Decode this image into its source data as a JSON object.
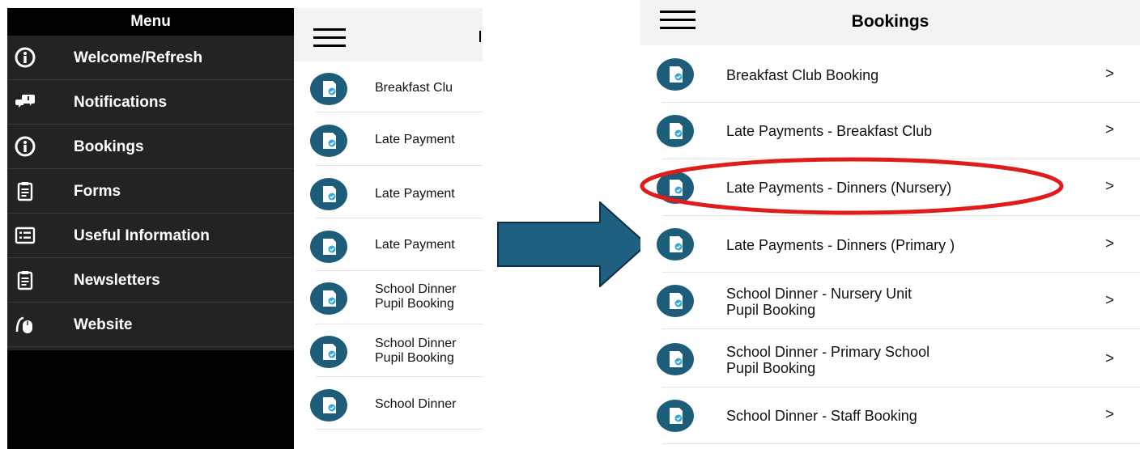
{
  "colors": {
    "menu_background": "#000000",
    "menu_list_background": "#232323",
    "topbar_background": "#f3f3f3",
    "booking_icon_color": "#1d5d79",
    "arrow_fill": "#1f5f7f",
    "highlight_ring": "#e01b1b"
  },
  "menu": {
    "title": "Menu",
    "items": [
      {
        "label": "Welcome/Refresh",
        "icon": "info-circle-icon"
      },
      {
        "label": "Notifications",
        "icon": "chat-bubbles-icon"
      },
      {
        "label": "Bookings",
        "icon": "info-circle-icon"
      },
      {
        "label": "Forms",
        "icon": "clipboard-icon"
      },
      {
        "label": "Useful Information",
        "icon": "list-card-icon"
      },
      {
        "label": "Newsletters",
        "icon": "clipboard-icon"
      },
      {
        "label": "Website",
        "icon": "mouse-click-icon"
      }
    ]
  },
  "mid_panel": {
    "rows": [
      {
        "line1": "Breakfast Clu",
        "line2": ""
      },
      {
        "line1": "Late Payment",
        "line2": ""
      },
      {
        "line1": "Late Payment",
        "line2": ""
      },
      {
        "line1": "Late Payment",
        "line2": ""
      },
      {
        "line1": "School Dinner",
        "line2": "Pupil Booking"
      },
      {
        "line1": "School Dinner",
        "line2": "Pupil Booking"
      },
      {
        "line1": "School Dinner",
        "line2": ""
      }
    ]
  },
  "bookings": {
    "title": "Bookings",
    "chevron": ">",
    "items": [
      {
        "line1": "Breakfast Club Booking",
        "line2": "",
        "highlighted": false
      },
      {
        "line1": "Late Payments - Breakfast Club",
        "line2": "",
        "highlighted": false
      },
      {
        "line1": "Late Payments - Dinners (Nursery)",
        "line2": "",
        "highlighted": true
      },
      {
        "line1": "Late Payments - Dinners (Primary )",
        "line2": "",
        "highlighted": false
      },
      {
        "line1": "School Dinner - Nursery Unit",
        "line2": "Pupil Booking",
        "highlighted": false
      },
      {
        "line1": "School Dinner - Primary School",
        "line2": "Pupil Booking",
        "highlighted": false
      },
      {
        "line1": "School Dinner - Staff Booking",
        "line2": "",
        "highlighted": false
      }
    ]
  }
}
